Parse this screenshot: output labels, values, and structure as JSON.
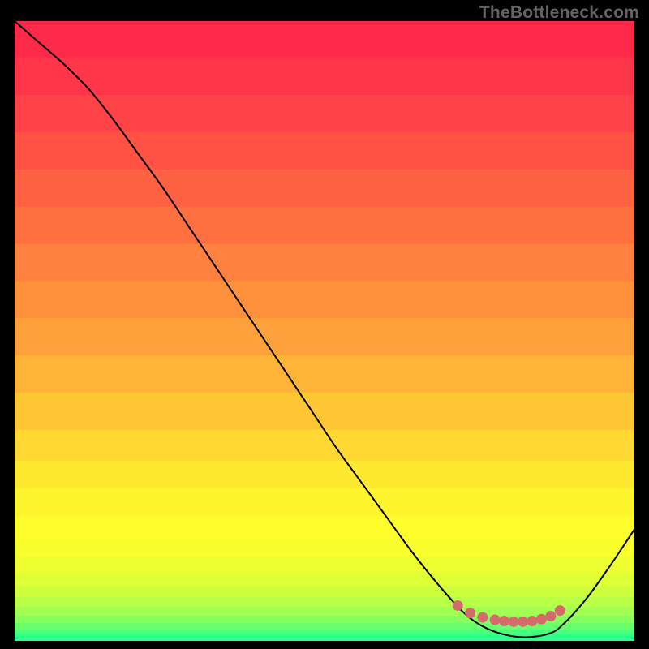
{
  "watermark": "TheBottleneck.com",
  "chart_data": {
    "type": "line",
    "title": "",
    "xlabel": "",
    "ylabel": "",
    "xlim": [
      0,
      100
    ],
    "ylim": [
      0,
      100
    ],
    "grid": false,
    "legend": false,
    "series": [
      {
        "name": "curve",
        "color": "#000000",
        "width": 2,
        "x": [
          0,
          4,
          8,
          12,
          16,
          20,
          24,
          28,
          32,
          36,
          40,
          44,
          48,
          52,
          56,
          60,
          64,
          68,
          72,
          74,
          76,
          78,
          80,
          82,
          84,
          86,
          88,
          92,
          96,
          100
        ],
        "y": [
          100,
          96.5,
          93,
          89,
          84,
          78.5,
          73,
          67,
          61,
          55,
          49,
          43,
          37,
          31,
          25.5,
          20,
          14.5,
          9.5,
          5,
          3.3,
          2.1,
          1.3,
          0.8,
          0.6,
          0.7,
          1.1,
          2.2,
          6.5,
          12,
          18
        ]
      },
      {
        "name": "highlight-dots",
        "color": "#d46a6a",
        "marker_radius": 6.5,
        "x": [
          71.5,
          73.5,
          75.5,
          77.5,
          79.0,
          80.5,
          82.0,
          83.5,
          85.0,
          86.5,
          88.0
        ],
        "y": [
          5.7,
          4.5,
          3.8,
          3.4,
          3.2,
          3.1,
          3.1,
          3.2,
          3.5,
          4.0,
          4.9
        ]
      }
    ],
    "gradient_bands": [
      {
        "stop": 0.0,
        "color": "#ff2a4a"
      },
      {
        "stop": 0.06,
        "color": "#ff3549"
      },
      {
        "stop": 0.12,
        "color": "#ff4347"
      },
      {
        "stop": 0.18,
        "color": "#ff5245"
      },
      {
        "stop": 0.24,
        "color": "#ff6143"
      },
      {
        "stop": 0.3,
        "color": "#ff7041"
      },
      {
        "stop": 0.36,
        "color": "#ff803f"
      },
      {
        "stop": 0.42,
        "color": "#ff903c"
      },
      {
        "stop": 0.48,
        "color": "#ffa13a"
      },
      {
        "stop": 0.54,
        "color": "#ffb337"
      },
      {
        "stop": 0.6,
        "color": "#ffc634"
      },
      {
        "stop": 0.66,
        "color": "#ffd931"
      },
      {
        "stop": 0.71,
        "color": "#ffe92f"
      },
      {
        "stop": 0.755,
        "color": "#fff52d"
      },
      {
        "stop": 0.8,
        "color": "#fffd2c"
      },
      {
        "stop": 0.835,
        "color": "#f9ff2d"
      },
      {
        "stop": 0.865,
        "color": "#edff31"
      },
      {
        "stop": 0.89,
        "color": "#dfff36"
      },
      {
        "stop": 0.912,
        "color": "#cdff3d"
      },
      {
        "stop": 0.93,
        "color": "#b8ff46"
      },
      {
        "stop": 0.946,
        "color": "#a1ff51"
      },
      {
        "stop": 0.96,
        "color": "#86ff5d"
      },
      {
        "stop": 0.972,
        "color": "#69ff6c"
      },
      {
        "stop": 0.982,
        "color": "#4cff7b"
      },
      {
        "stop": 0.99,
        "color": "#2fff8c"
      },
      {
        "stop": 1.0,
        "color": "#14ff9d"
      }
    ]
  }
}
